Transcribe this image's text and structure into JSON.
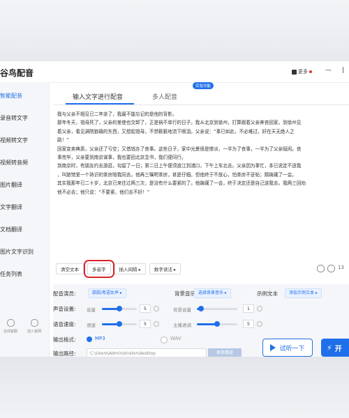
{
  "window": {
    "title": "谷鸟配音",
    "more_label": "更多",
    "minimize": "—",
    "close": "|"
  },
  "sidebar": {
    "items": [
      {
        "label": "智能配音",
        "active": true
      },
      {
        "label": "录音转文字"
      },
      {
        "label": "视频转文字"
      },
      {
        "label": "视频转音频"
      },
      {
        "label": "图片翻译"
      },
      {
        "label": "文字翻译"
      },
      {
        "label": "文档翻译"
      },
      {
        "label": "图片文字识别"
      },
      {
        "label": "任务列表"
      }
    ],
    "bottom": [
      {
        "label": "在线客服"
      },
      {
        "label": "加入官网"
      }
    ]
  },
  "tabs": [
    {
      "label": "输入文字进行配音",
      "active": true
    },
    {
      "label": "多人配音"
    }
  ],
  "beta_badge": "实验功能",
  "editor_lines": [
    "我与父亲不相见已二年余了，我最不能忘记的是他的背影。",
    "那年冬天，祖母死了，父亲的差使也交卸了，正是祸不单行的日子。我从北京到徐州，打算跟着父亲奔丧回家。到徐州见",
    "着父亲，看见满院狼藉的东西，又想起祖母，不禁簌簌地流下眼泪。父亲说：“事已如此，不必难过，好在天无绝人之",
    "路！”",
    "回家变卖典质，父亲还了亏空；又借钱办了丧事。这些日子，家中光景很是惨淡，一半为了丧事，一半为了父亲赋闲。丧",
    "事完毕，父亲要到南京谋事，我也要回北京念书，我们便同行。",
    "到南京时，有朋友约去游逛，勾留了一日；第二日上午便须渡江到浦口，下午上车北去。父亲因为事忙，本已说定不送我",
    "，叫旅馆里一个熟识的茶房陪我同去。他再三嘱咐茶房，甚是仔细。但他终于不放心，怕茶房不妥帖；颇踌躇了一会。",
    "其实我那年已二十岁，北京已来往过两三次，是没有什么要紧的了。他踌躇了一会，终于决定还是自己送我去。我两三回劝",
    "他不必去；他只说：“不要紧，他们去不好！”"
  ],
  "toolbar": {
    "clear_label": "清空文本",
    "polyphone_label": "多音字",
    "pause_label": "插入间隔 ▸",
    "number_label": "数字读法 ▸",
    "char_count": "13"
  },
  "settings": {
    "voice_label": "配音演员:",
    "voice_value": "甜甜/粤语女声 ▸",
    "bgm_label": "背景音乐",
    "bgm_value": "选择背景音乐 ▸",
    "example_label": "示例文本",
    "example_value": "添加示例文本 ▸",
    "volume_row_label": "声音设置:",
    "volume_label": "音量",
    "volume_value": "5",
    "volume_fraction": 0.5,
    "bg_volume_label": "背景音量",
    "bg_volume_value": "1",
    "bg_volume_fraction": 0.1,
    "speed_row_label": "语音速度:",
    "speed_label": "语速",
    "speed_value": "5",
    "speed_fraction": 0.5,
    "pitch_label": "主播语调",
    "pitch_value": "5",
    "pitch_fraction": 0.5,
    "format_label": "输出格式:",
    "format_mp3": "MP3",
    "format_wav": "WAV",
    "format_selected": "MP3",
    "path_label": "输出路径:",
    "path_value": "C:\\Users\\Administrator\\desktop",
    "change_path_label": "更改路径"
  },
  "actions": {
    "listen_label": "试听一下",
    "start_label": "开"
  },
  "colors": {
    "accent": "#1f6feb",
    "highlight_box": "#d8262c"
  }
}
